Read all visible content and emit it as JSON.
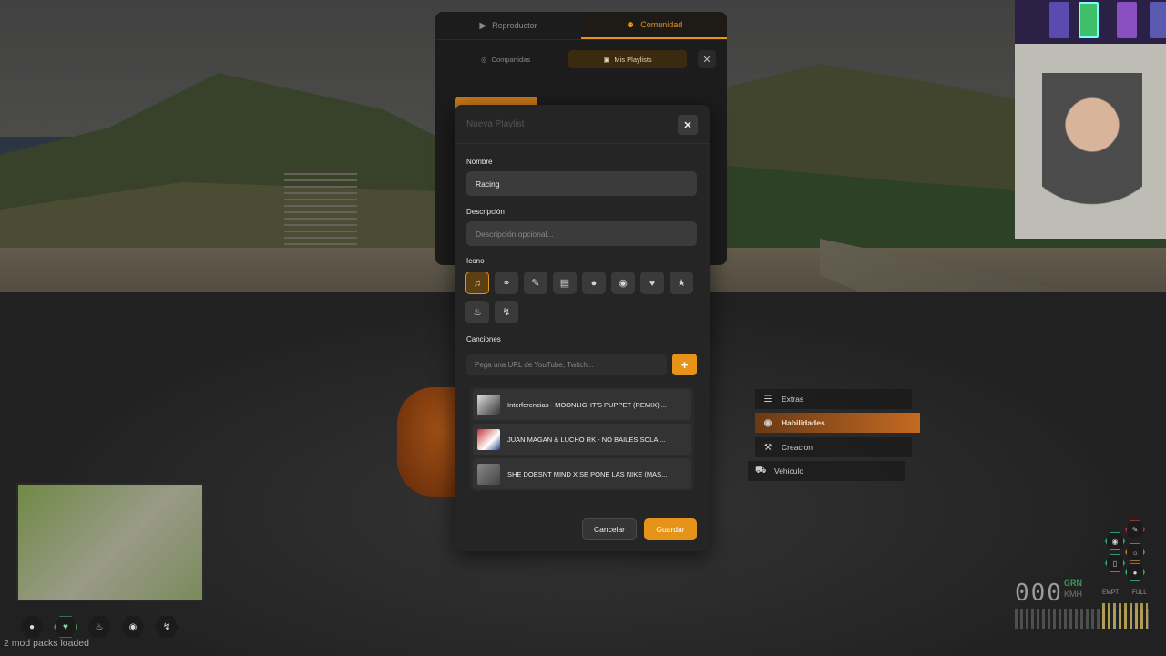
{
  "top_panel": {
    "tabs": [
      {
        "label": "Reproductor",
        "icon": "play-circle-icon"
      },
      {
        "label": "Comunidad",
        "icon": "users-icon"
      }
    ],
    "subtabs": [
      {
        "label": "Compartidas",
        "icon": "globe-icon"
      },
      {
        "label": "Mis Playlists",
        "icon": "folder-icon"
      }
    ]
  },
  "modal": {
    "title": "Nueva Playlist",
    "name_label": "Nombre",
    "name_value": "Racing",
    "description_label": "Descripción",
    "description_placeholder": "Descripción opcional...",
    "icon_label": "Icono",
    "icons": [
      "music-note-icon",
      "headphones-icon",
      "guitar-icon",
      "radio-icon",
      "microphone-icon",
      "disc-icon",
      "heart-icon",
      "star-icon",
      "fire-icon",
      "bolt-icon"
    ],
    "selected_icon": "music-note-icon",
    "songs_label": "Canciones",
    "url_placeholder": "Pega una URL de YouTube, Twitch...",
    "songs": [
      {
        "title": "Interferencias - MOONLIGHT'S PUPPET (REMIX) ..."
      },
      {
        "title": "JUAN MAGAN & LUCHO RK - NO BAILES SOLA ..."
      },
      {
        "title": "SHE DOESNT MIND X SE PONE LAS NIKE (MAS..."
      }
    ],
    "cancel_label": "Cancelar",
    "save_label": "Guardar",
    "accent_color": "#e6931a"
  },
  "radial_menu": {
    "items": [
      {
        "label": "Extras",
        "icon": "list-icon"
      },
      {
        "label": "Habilidades",
        "icon": "brain-icon",
        "highlighted": true
      },
      {
        "label": "Creacion",
        "icon": "hammer-icon"
      },
      {
        "label": "Vehiculo",
        "icon": "car-icon"
      }
    ]
  },
  "hud": {
    "mod_status": "2 mod packs loaded",
    "speed": "000",
    "gear": "GRN",
    "unit": "KMH",
    "fuel_empty": "EMPT",
    "fuel_full": "FULL"
  }
}
